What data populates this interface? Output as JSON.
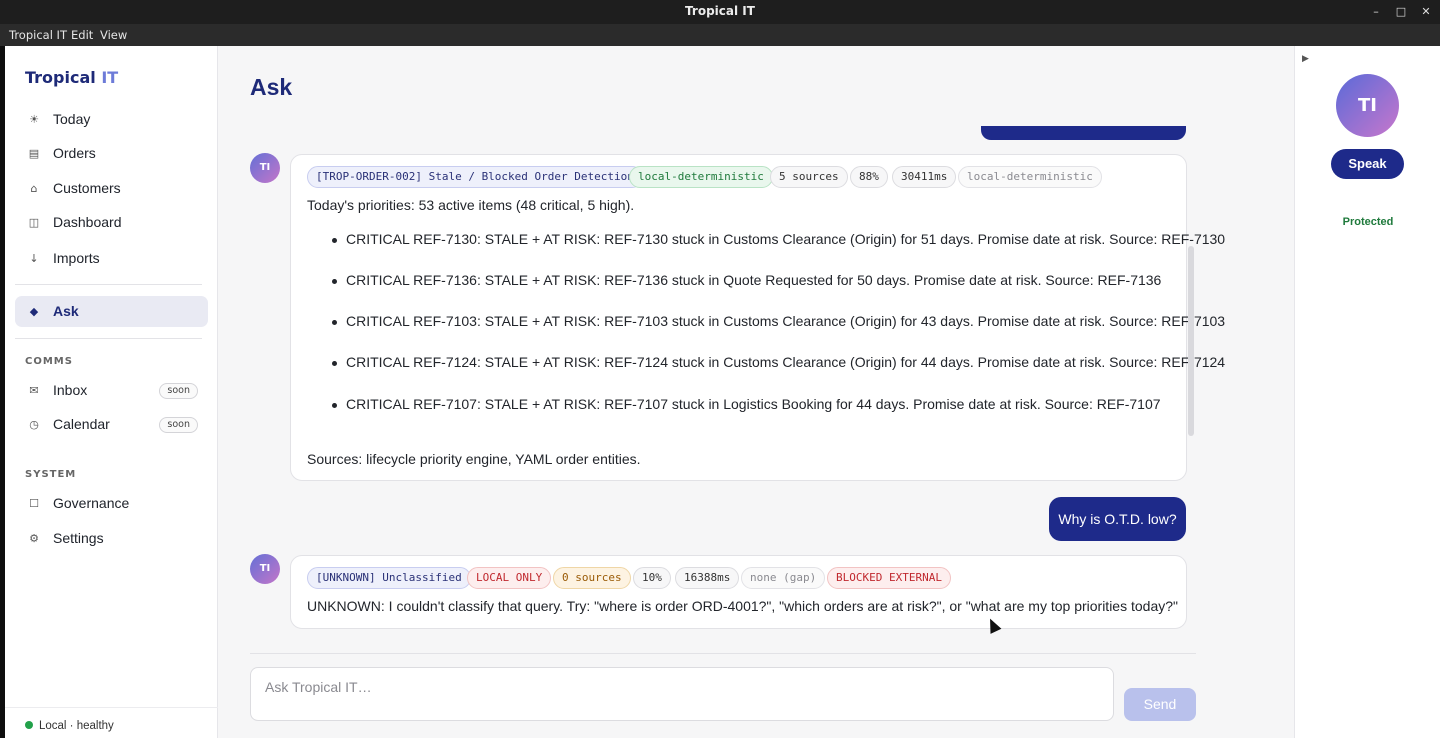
{
  "window": {
    "title": "Tropical IT",
    "minimize": "–",
    "maximize": "□",
    "close": "✕"
  },
  "menubar": [
    "Tropical IT",
    "Edit",
    "View"
  ],
  "sidebar": {
    "brand_primary": "Tropical",
    "brand_accent": "IT",
    "items": [
      {
        "label": "Today",
        "icon": "☀",
        "icon_name": "sun-icon"
      },
      {
        "label": "Orders",
        "icon": "▤",
        "icon_name": "orders-icon"
      },
      {
        "label": "Customers",
        "icon": "⌂",
        "icon_name": "home-icon"
      },
      {
        "label": "Dashboard",
        "icon": "◫",
        "icon_name": "dashboard-icon"
      },
      {
        "label": "Imports",
        "icon": "↓",
        "icon_name": "download-icon"
      },
      {
        "label": "Ask",
        "icon": "◆",
        "icon_name": "diamond-icon",
        "active": true
      }
    ],
    "comms_label": "COMMS",
    "comms_items": [
      {
        "label": "Inbox",
        "icon": "✉",
        "badge": "soon"
      },
      {
        "label": "Calendar",
        "icon": "◷",
        "badge": "soon"
      }
    ],
    "system_label": "SYSTEM",
    "system_items": [
      {
        "label": "Governance",
        "icon": "☐"
      },
      {
        "label": "Settings",
        "icon": "⚙"
      }
    ],
    "status": "Local · healthy",
    "status_color": "#22a14a"
  },
  "main": {
    "title": "Ask",
    "messages": [
      {
        "role": "assistant",
        "avatar": "TI",
        "chips": [
          "[TROP-ORDER-002] Stale / Blocked Order Detection",
          "local-deterministic",
          "5 sources",
          "88%",
          "30411ms",
          "local-deterministic"
        ],
        "intro": "Today's priorities: 53 active items (48 critical, 5 high).",
        "bullets": [
          "CRITICAL REF-7130: STALE + AT RISK: REF-7130 stuck in Customs Clearance (Origin) for 51 days. Promise date at risk. Source: REF-7130",
          "CRITICAL REF-7136: STALE + AT RISK: REF-7136 stuck in Quote Requested for 50 days. Promise date at risk. Source: REF-7136",
          "CRITICAL REF-7103: STALE + AT RISK: REF-7103 stuck in Customs Clearance (Origin) for 43 days. Promise date at risk. Source: REF-7103",
          "CRITICAL REF-7124: STALE + AT RISK: REF-7124 stuck in Customs Clearance (Origin) for 44 days. Promise date at risk. Source: REF-7124",
          "CRITICAL REF-7107: STALE + AT RISK: REF-7107 stuck in Logistics Booking for 44 days. Promise date at risk. Source: REF-7107"
        ],
        "footer": "Sources: lifecycle priority engine, YAML order entities."
      },
      {
        "role": "user",
        "text": "Why is O.T.D. low?"
      },
      {
        "role": "assistant",
        "avatar": "TI",
        "chips": [
          "[UNKNOWN] Unclassified",
          "LOCAL ONLY",
          "0 sources",
          "10%",
          "16388ms",
          "none (gap)",
          "BLOCKED EXTERNAL"
        ],
        "text": "UNKNOWN: I couldn't classify that query. Try: \"where is order ORD-4001?\", \"which orders are at risk?\", or \"what are my top priorities today?\""
      }
    ],
    "composer_placeholder": "Ask Tropical IT…",
    "send_label": "Send"
  },
  "right_panel": {
    "toggle": "▶",
    "avatar": "TI",
    "speak_label": "Speak",
    "protected_label": "Protected"
  },
  "colors": {
    "brand": "#1e2a78",
    "accent": "#1e2a8a",
    "ok": "#1f7a3c",
    "danger": "#c0282e"
  }
}
